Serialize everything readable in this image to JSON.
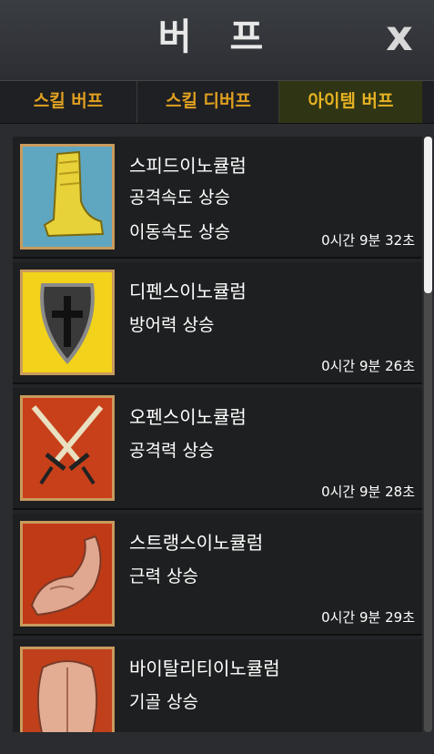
{
  "header": {
    "title": "버 프",
    "close_label": "x"
  },
  "tabs": [
    {
      "label": "스킬 버프",
      "active": false
    },
    {
      "label": "스킬 디버프",
      "active": false
    },
    {
      "label": "아이템 버프",
      "active": true
    }
  ],
  "items": [
    {
      "name": "스피드이노큘럼",
      "effects": [
        "공격속도 상승",
        "이동속도 상승"
      ],
      "timer": "0시간 9분 32초",
      "icon": "boot-icon"
    },
    {
      "name": "디펜스이노큘럼",
      "effects": [
        "방어력 상승"
      ],
      "timer": "0시간 9분 26초",
      "icon": "shield-icon"
    },
    {
      "name": "오펜스이노큘럼",
      "effects": [
        "공격력 상승"
      ],
      "timer": "0시간 9분 28초",
      "icon": "swords-icon"
    },
    {
      "name": "스트랭스이노큘럼",
      "effects": [
        "근력 상승"
      ],
      "timer": "0시간 9분 29초",
      "icon": "muscle-arm-icon"
    },
    {
      "name": "바이탈리티이노큘럼",
      "effects": [
        "기골 상승"
      ],
      "timer": "",
      "icon": "back-icon"
    }
  ],
  "colors": {
    "accent": "#e0a020",
    "active_tab_bg": "#2f3514",
    "frame": "#c99a5e"
  }
}
